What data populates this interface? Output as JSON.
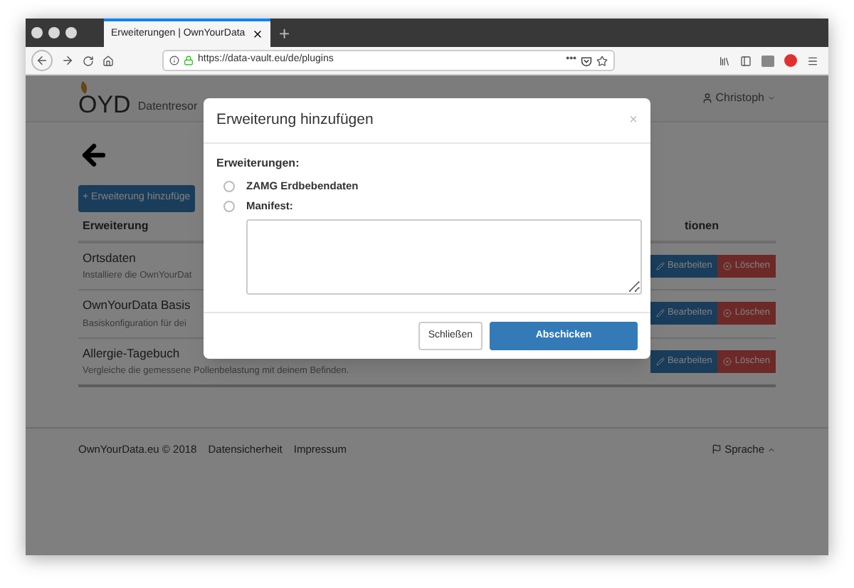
{
  "browser": {
    "tab_title": "Erweiterungen | OwnYourData",
    "new_tab": "+",
    "url": "https://data-vault.eu/de/plugins",
    "page_actions": "•••"
  },
  "page": {
    "logo": "OYD",
    "brand": "Datentresor",
    "user": "Christoph",
    "add_button": "+ Erweiterung hinzufüge",
    "table": {
      "columns": [
        "Erweiterung",
        "tionen"
      ],
      "rows": [
        {
          "name": "Ortsdaten",
          "description": "Installiere die OwnYourDat",
          "edit": "Bearbeiten",
          "delete": "Löschen"
        },
        {
          "name": "OwnYourData Basis",
          "description": "Basiskonfiguration für dei",
          "edit": "Bearbeiten",
          "delete": "Löschen"
        },
        {
          "name": "Allergie-Tagebuch",
          "description": "Vergleiche die gemessene Pollenbelastung mit deinem Befinden.",
          "edit": "Bearbeiten",
          "delete": "Löschen"
        }
      ]
    },
    "footer": {
      "copyright": "OwnYourData.eu © 2018",
      "links": [
        "Datensicherheit",
        "Impressum"
      ],
      "language": "Sprache"
    }
  },
  "modal": {
    "title": "Erweiterung hinzufügen",
    "close": "×",
    "label": "Erweiterungen:",
    "options": [
      {
        "label": "ZAMG Erdbebendaten",
        "selected": false
      },
      {
        "label": "Manifest:",
        "selected": false
      }
    ],
    "cancel": "Schließen",
    "submit": "Abschicken"
  }
}
